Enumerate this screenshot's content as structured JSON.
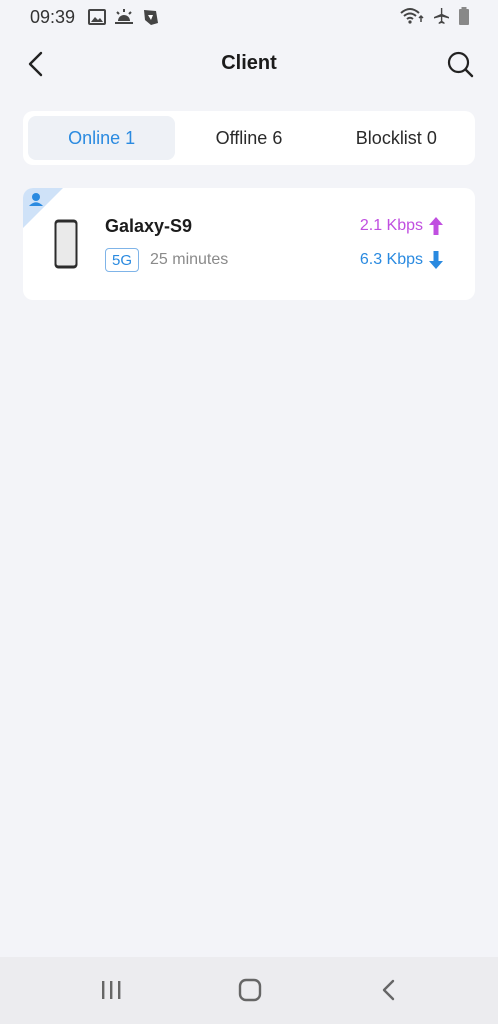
{
  "status_bar": {
    "time": "09:39",
    "left_icons": [
      "image-icon",
      "sunrise-icon",
      "app-badge-icon"
    ],
    "right_icons": [
      "wifi-icon",
      "airplane-mode-icon",
      "battery-icon"
    ]
  },
  "header": {
    "title": "Client",
    "back_icon": "chevron-left-icon",
    "search_icon": "search-icon"
  },
  "tabs": [
    {
      "label": "Online",
      "count": "1",
      "active": true
    },
    {
      "label": "Offline",
      "count": "6",
      "active": false
    },
    {
      "label": "Blocklist",
      "count": "0",
      "active": false
    }
  ],
  "clients": [
    {
      "name": "Galaxy-S9",
      "band": "5G",
      "duration": "25 minutes",
      "upload": "2.1 Kbps",
      "download": "6.3 Kbps",
      "icon": "smartphone-icon",
      "corner_icon": "user-icon"
    }
  ],
  "nav_bar": {
    "buttons": [
      "recent-apps-icon",
      "home-icon",
      "back-icon"
    ]
  },
  "colors": {
    "accent": "#2a8ae0",
    "upload": "#c04fe0",
    "background": "#f3f4f8",
    "card": "#ffffff"
  }
}
